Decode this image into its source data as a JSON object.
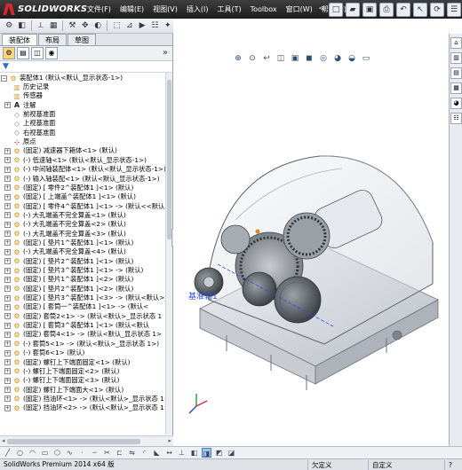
{
  "app": {
    "logo_prefix": "3S",
    "logo_text": "SOLIDWORKS",
    "menus": [
      {
        "label": "文件(F)"
      },
      {
        "label": "编辑(E)"
      },
      {
        "label": "视图(V)"
      },
      {
        "label": "插入(I)"
      },
      {
        "label": "工具(T)"
      },
      {
        "label": "Toolbox"
      },
      {
        "label": "窗口(W)"
      },
      {
        "label": "帮助(H)"
      }
    ]
  },
  "panel": {
    "tabs": [
      "装配体",
      "布局",
      "草图"
    ],
    "active_tab": "装配体"
  },
  "tree": {
    "root": "装配体1  (默认<默认_显示状态-1>)",
    "items": [
      {
        "text": "历史记录",
        "icon": "folder"
      },
      {
        "text": "传感器",
        "icon": "folder"
      },
      {
        "text": "注解",
        "icon": "note",
        "exp": "+"
      },
      {
        "text": "前视基准面",
        "icon": "plane"
      },
      {
        "text": "上视基准面",
        "icon": "plane"
      },
      {
        "text": "右视基准面",
        "icon": "plane"
      },
      {
        "text": "原点",
        "icon": "origin"
      },
      {
        "text": "(固定) 减速器下箱体<1> (默认)",
        "icon": "part",
        "exp": "+"
      },
      {
        "text": "(-) 低速轴<1> (默认<默认_显示状态-1>)",
        "icon": "assy",
        "exp": "+"
      },
      {
        "text": "(-) 中间轴装配体<1> (默认<默认_显示状态-1>)",
        "icon": "assy",
        "exp": "+"
      },
      {
        "text": "(-) 输入轴装配<1> (默认<默认_显示状态-1>)",
        "icon": "assy",
        "exp": "+"
      },
      {
        "text": "(固定) [ 零件2^装配体1 ]<1> (默认)",
        "icon": "part",
        "exp": "+"
      },
      {
        "text": "(固定) [ 上端盖^装配体1 ]<1> (默认)",
        "icon": "part",
        "exp": "+"
      },
      {
        "text": "(固定) [ 零件4^装配体1 ]<1> -> (默认<<默认",
        "icon": "part",
        "exp": "+"
      },
      {
        "text": "(-) 大孔端盖不完全算盖<1> (默认)",
        "icon": "part",
        "exp": "+"
      },
      {
        "text": "(-) 大孔端盖不完全算盖<2> (默认)",
        "icon": "part",
        "exp": "+"
      },
      {
        "text": "(-) 大孔端盖不完全算盖<3> (默认)",
        "icon": "part",
        "exp": "+"
      },
      {
        "text": "(固定) [ 垫片1^装配体1 ]<1> (默认)",
        "icon": "part",
        "exp": "+"
      },
      {
        "text": "(-) 大孔端盖不完全算盖<4> (默认)",
        "icon": "part",
        "exp": "+"
      },
      {
        "text": "(固定) [ 垫片2^装配体1 ]<1> (默认)",
        "icon": "part",
        "exp": "+"
      },
      {
        "text": "(固定) [ 垫片3^装配体1 ]<1> -> (默认)",
        "icon": "part",
        "exp": "+"
      },
      {
        "text": "(固定) [ 垫片1^装配体1 ]<2> (默认)",
        "icon": "part",
        "exp": "+"
      },
      {
        "text": "(固定) [ 垫片2^装配体1 ]<2> (默认)",
        "icon": "part",
        "exp": "+"
      },
      {
        "text": "(固定) [ 垫片3^装配体1 ]<3> -> (默认<默认>_显示状",
        "icon": "part",
        "exp": "+"
      },
      {
        "text": "(固定) [ 套筒一^装配体1 ]<1> -> (默认<",
        "icon": "part",
        "exp": "+"
      },
      {
        "text": "(固定) 套筒2<1> -> (默认<默认>_显示状态 1",
        "icon": "part",
        "exp": "+"
      },
      {
        "text": "(固定) [ 套筒3^装配体1 ]<1> (默认<默认",
        "icon": "part",
        "exp": "+"
      },
      {
        "text": "(固定) 套筒4<1> -> (默认<默认_显示状态 1>",
        "icon": "part",
        "exp": "+"
      },
      {
        "text": "(-) 套筒5<1> -> (默认<默认>_显示状态 1>)",
        "icon": "part",
        "exp": "+"
      },
      {
        "text": "(-) 套筒6<1> (默认)",
        "icon": "part",
        "exp": "+"
      },
      {
        "text": "(固定) 螺钉上下端面固定<1> (默认)",
        "icon": "part",
        "exp": "+"
      },
      {
        "text": "(-) 螺钉上下端面固定<2> (默认)",
        "icon": "part",
        "exp": "+"
      },
      {
        "text": "(-) 螺钉上下端面固定<3> (默认)",
        "icon": "part",
        "exp": "+"
      },
      {
        "text": "(固定) 螺钉上下端面大<1> (默认)",
        "icon": "part",
        "exp": "+"
      },
      {
        "text": "(固定) 挡油环<1> -> (默认<默认>_显示状态 1>",
        "icon": "part",
        "exp": "+"
      },
      {
        "text": "(固定) 挡油环<2> -> (默认<默认>_显示状态 1>",
        "icon": "part",
        "exp": "+"
      }
    ]
  },
  "viewport": {
    "axis_label": "基准轴1"
  },
  "status": {
    "left": "SolidWorks Premium 2014 x64 版",
    "cells": [
      "欠定义",
      "自定义",
      "?"
    ]
  }
}
